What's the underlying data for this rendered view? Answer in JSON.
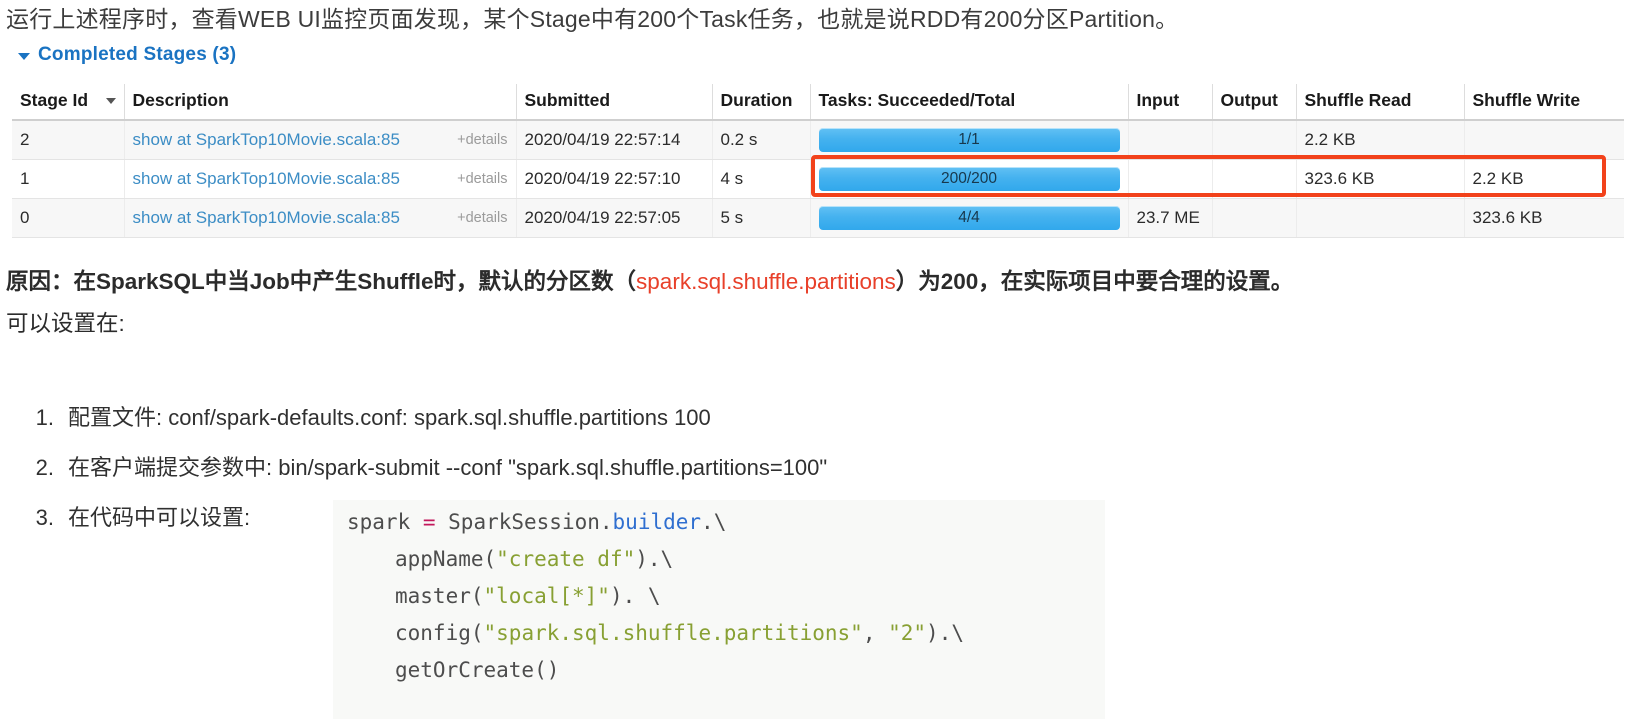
{
  "intro": {
    "text": "运行上述程序时，查看WEB UI监控页面发现，某个Stage中有200个Task任务，也就是说RDD有200分区Partition。"
  },
  "section": {
    "caret_icon": "triangle-down-icon",
    "title": "Completed Stages (3)"
  },
  "table": {
    "columns": [
      "Stage Id",
      "Description",
      "Submitted",
      "Duration",
      "Tasks: Succeeded/Total",
      "Input",
      "Output",
      "Shuffle Read",
      "Shuffle Write"
    ],
    "sort_indicator_icon": "sort-desc-icon",
    "rows": [
      {
        "stage_id": "2",
        "description": "show at SparkTop10Movie.scala:85",
        "details": "+details",
        "submitted": "2020/04/19 22:57:14",
        "duration": "0.2 s",
        "tasks": "1/1",
        "tasks_progress_pct": 100,
        "input": "",
        "output": "",
        "shuffle_read": "2.2 KB",
        "shuffle_write": "",
        "highlighted": false
      },
      {
        "stage_id": "1",
        "description": "show at SparkTop10Movie.scala:85",
        "details": "+details",
        "submitted": "2020/04/19 22:57:10",
        "duration": "4 s",
        "tasks": "200/200",
        "tasks_progress_pct": 100,
        "input": "",
        "output": "",
        "shuffle_read": "323.6 KB",
        "shuffle_write": "2.2 KB",
        "highlighted": true
      },
      {
        "stage_id": "0",
        "description": "show at SparkTop10Movie.scala:85",
        "details": "+details",
        "submitted": "2020/04/19 22:57:05",
        "duration": "5 s",
        "tasks": "4/4",
        "tasks_progress_pct": 100,
        "input": "23.7 ME",
        "output": "",
        "shuffle_read": "",
        "shuffle_write": "323.6 KB",
        "highlighted": false
      }
    ],
    "highlight_color": "#f2421b",
    "progress_color": "#45b2ef"
  },
  "reason": {
    "prefix": "原因：在SparkSQL中当Job中产生Shuffle时，默认的分区数（",
    "config_key": "spark.sql.shuffle.partitions",
    "suffix": "）为200，在实际项目中要合理的设置。",
    "line2": "可以设置在:",
    "accent_color": "#e8402a"
  },
  "steps": [
    {
      "num": "1.",
      "text": "配置文件: conf/spark-defaults.conf:    spark.sql.shuffle.partitions 100"
    },
    {
      "num": "2.",
      "text": "在客户端提交参数中: bin/spark-submit --conf \"spark.sql.shuffle.partitions=100\""
    },
    {
      "num": "3.",
      "text": "在代码中可以设置:"
    }
  ],
  "code": {
    "line1": {
      "var": "spark ",
      "op": "=",
      "rest": " SparkSession.",
      "attr": "builder",
      "tail": ".\\"
    },
    "line2": {
      "fn": "appName(",
      "str": "\"create df\"",
      "tail": ").\\"
    },
    "line3": {
      "fn": "master(",
      "str": "\"local[*]\"",
      "tail": "). \\"
    },
    "line4": {
      "fn": "config(",
      "str1": "\"spark.sql.shuffle.partitions\"",
      "comma": ", ",
      "str2": "\"2\"",
      "tail": ").\\"
    },
    "line5": {
      "fn": "getOrCreate()"
    }
  }
}
